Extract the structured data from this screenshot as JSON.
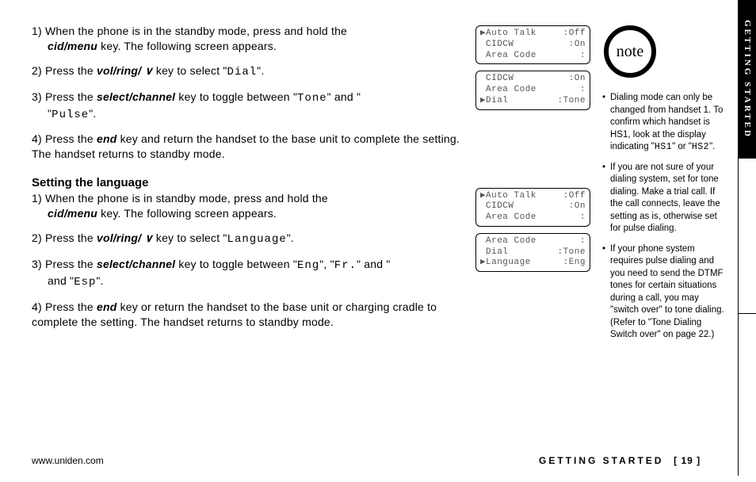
{
  "section_tab": "GETTING STARTED",
  "main": {
    "block1": [
      {
        "num": "1)",
        "text_a": "When the phone is in the standby mode, press and hold the",
        "text_b_strong": "cid/menu",
        "text_c": " key. The following screen appears."
      },
      {
        "num": "2)",
        "text_a": "Press the ",
        "text_b_strong": "vol/ring/ ",
        "caret": "∨",
        "text_c": " key to select \"",
        "mono": "Dial",
        "text_d": "\"."
      },
      {
        "num": "3)",
        "text_a": "Press the ",
        "text_b_strong": "select/channel",
        "text_c": " key to toggle between \"",
        "mono_a": "Tone",
        "mid": "\" and \"",
        "mono_b": "Pulse",
        "text_d": "\"."
      },
      {
        "num": "4)",
        "text_a": "Press the ",
        "text_b_strong": "end",
        "text_c": " key and return the handset to the base unit to complete the setting. The handset returns to standby mode."
      }
    ],
    "heading": "Setting the language",
    "block2": [
      {
        "num": "1)",
        "text_a": "When the phone is in standby mode, press and hold the",
        "text_b_strong": "cid/menu",
        "text_c": " key. The following screen appears."
      },
      {
        "num": "2)",
        "text_a": "Press the ",
        "text_b_strong": "vol/ring/ ",
        "caret": "∨",
        "text_c": " key to select \"",
        "mono": "Language",
        "text_d": "\"."
      },
      {
        "num": "3)",
        "text_a": "Press the ",
        "text_b_strong": "select/channel",
        "text_c": " key to toggle between \"",
        "mono_a": "Eng",
        "mid_a": "\", \"",
        "mono_b": "Fr.",
        "mid_b": "\" and \"",
        "mono_c": "Esp",
        "text_d": "\"."
      },
      {
        "num": "4)",
        "text_a": "Press the ",
        "text_b_strong": "end",
        "text_c": " key or return the handset to the base unit or charging cradle to complete the setting. The handset returns to standby mode."
      }
    ]
  },
  "screens": {
    "s1": [
      {
        "cursor": "▶",
        "label": "Auto Talk",
        "val": ":Off"
      },
      {
        "cursor": " ",
        "label": "CIDCW",
        "val": ":On"
      },
      {
        "cursor": " ",
        "label": "Area Code",
        "val": ":"
      }
    ],
    "s2": [
      {
        "cursor": " ",
        "label": "CIDCW",
        "val": ":On"
      },
      {
        "cursor": " ",
        "label": "Area Code",
        "val": ":"
      },
      {
        "cursor": "▶",
        "label": "Dial",
        "val": ":Tone"
      }
    ],
    "s3": [
      {
        "cursor": "▶",
        "label": "Auto Talk",
        "val": ":Off"
      },
      {
        "cursor": " ",
        "label": "CIDCW",
        "val": ":On"
      },
      {
        "cursor": " ",
        "label": "Area Code",
        "val": ":"
      }
    ],
    "s4": [
      {
        "cursor": " ",
        "label": "Area Code",
        "val": ":"
      },
      {
        "cursor": " ",
        "label": "Dial",
        "val": ":Tone"
      },
      {
        "cursor": "▶",
        "label": "Language",
        "val": ":Eng"
      }
    ]
  },
  "note": {
    "label": "note",
    "bullets": [
      {
        "pre": "Dialing mode can only be changed from handset 1. To confirm which handset is HS1, look at the display indicating \"",
        "m1": "HS1",
        "mid": "\" or \"",
        "m2": "HS2",
        "post": "\"."
      },
      {
        "pre": "If you are not sure of your dialing system, set for tone dialing. Make a trial call. If the call connects, leave the setting as is, otherwise set for pulse dialing."
      },
      {
        "pre": "If your phone system requires pulse dialing and you need to send the DTMF tones for certain situations during a call, you may \"switch over\" to tone dialing. (Refer to \"Tone Dialing Switch over\" on page 22.)"
      }
    ]
  },
  "footer": {
    "url": "www.uniden.com",
    "section": "GETTING STARTED",
    "page": "[ 19 ]"
  }
}
